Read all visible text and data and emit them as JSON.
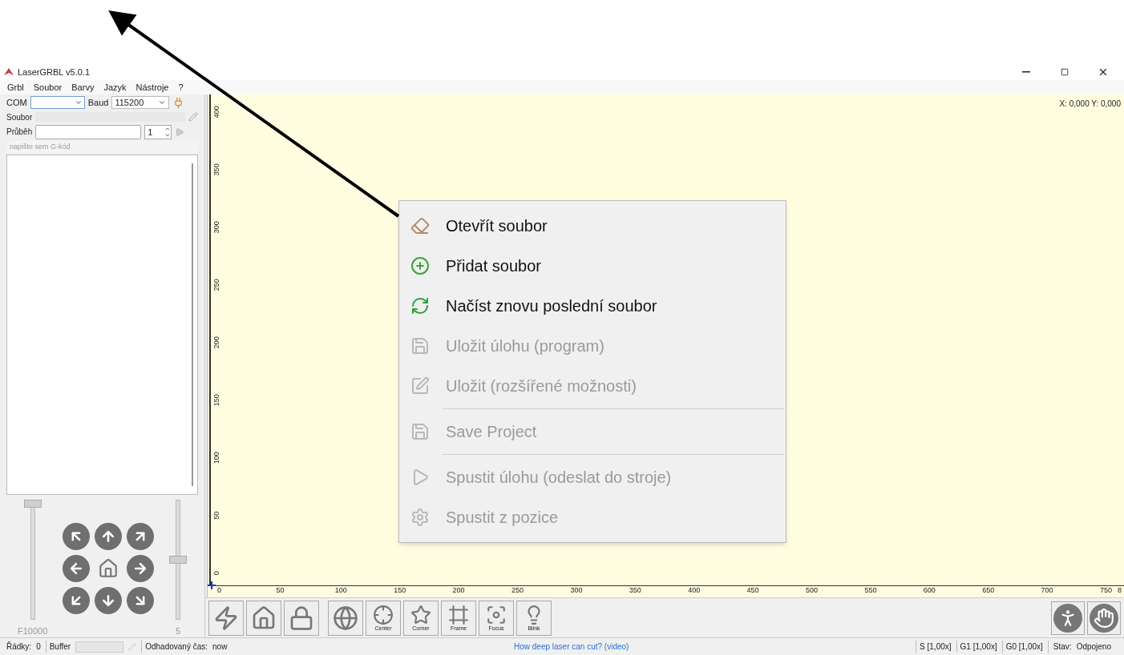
{
  "window": {
    "title": "LaserGRBL v5.0.1"
  },
  "menu_bar": [
    "Grbl",
    "Soubor",
    "Barvy",
    "Jazyk",
    "Nástroje",
    "?"
  ],
  "connection": {
    "port_label": "COM",
    "baud_label": "Baud",
    "baud_value": "115200"
  },
  "file": {
    "label": "Soubor"
  },
  "progress": {
    "label": "Průběh",
    "copies": "1"
  },
  "gcode_input": {
    "placeholder": "napište sem G-kód"
  },
  "jog": {
    "speed": {
      "level": 1,
      "reading": "F10000"
    },
    "step": {
      "level": 0.5,
      "reading": "5"
    }
  },
  "canvas": {
    "coordinates": "X: 0,000 Y: 0,000",
    "x_ruler": [
      "0",
      "50",
      "100",
      "150",
      "200",
      "250",
      "300",
      "350",
      "400",
      "450",
      "500",
      "550",
      "600",
      "650",
      "700",
      "750",
      "8"
    ],
    "y_ruler": [
      "0",
      "50",
      "100",
      "150",
      "200",
      "250",
      "300",
      "350",
      "400"
    ]
  },
  "toolbar": [
    {
      "kind": "reset"
    },
    {
      "kind": "homing"
    },
    {
      "kind": "unlock"
    },
    {
      "kind": "goto"
    },
    {
      "kind": "center",
      "label": "Center"
    },
    {
      "kind": "corner",
      "label": "Corner"
    },
    {
      "kind": "frame",
      "label": "Frame"
    },
    {
      "kind": "focus",
      "label": "Focus"
    },
    {
      "kind": "blink",
      "label": "Blink"
    }
  ],
  "toolbar_right": [
    {
      "kind": "resume"
    },
    {
      "kind": "abort"
    }
  ],
  "context_menu": [
    {
      "kind": "item",
      "label": "Otevřít soubor",
      "disabled": false
    },
    {
      "kind": "item",
      "label": "Přidat soubor",
      "disabled": false
    },
    {
      "kind": "item",
      "label": "Načíst znovu poslední soubor",
      "disabled": false
    },
    {
      "kind": "item",
      "label": "Uložit úlohu (program)",
      "disabled": true
    },
    {
      "kind": "item",
      "label": "Uložit (rozšířené možnosti)",
      "disabled": true
    },
    {
      "kind": "separator"
    },
    {
      "kind": "item",
      "label": "Save Project",
      "disabled": true
    },
    {
      "kind": "separator"
    },
    {
      "kind": "item",
      "label": "Spustit úlohu (odeslat do stroje)",
      "disabled": true
    },
    {
      "kind": "item",
      "label": "Spustit z pozice",
      "disabled": true
    }
  ],
  "status_bar": {
    "lines_label": "Řádky:",
    "lines": "0",
    "buffer_label": "Buffer",
    "time_label": "Odhadovaný čas:",
    "time": "now",
    "link": "How deep laser can cut? (video)",
    "overrides": [
      "S [1,00x]",
      "G1 [1,00x]",
      "G0 [1,00x]"
    ],
    "state_label": "Stav:",
    "state": "Odpojeno"
  }
}
